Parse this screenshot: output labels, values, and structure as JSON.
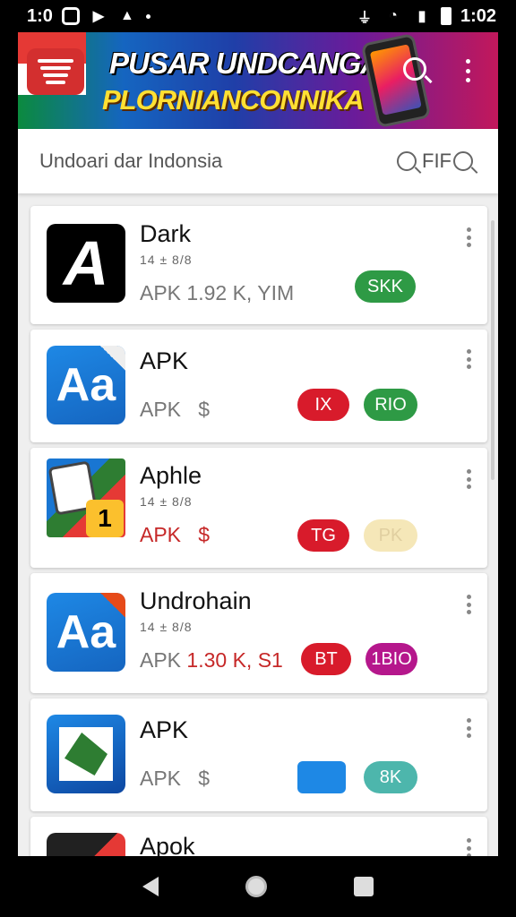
{
  "status_bar": {
    "time_left": "1:0",
    "time_right": "1:02"
  },
  "banner": {
    "title": "PUSAR UNDCANGAN",
    "subtitle": "PLORNIANCONNIKA"
  },
  "search": {
    "placeholder": "Undoari dar Indonsia",
    "filter_label": "FIF"
  },
  "apps": [
    {
      "name": "Dark",
      "meta": "14 ± 8/8",
      "info": "APK 1.92 K, YIM",
      "info_hl": "",
      "pills": [
        {
          "label": "SKK",
          "color": "#2e9a45"
        }
      ],
      "icon_letter": "A"
    },
    {
      "name": "APK",
      "meta": "",
      "info": "APK",
      "info_hl": "$",
      "pills": [
        {
          "label": "IX",
          "color": "#d81b2b"
        },
        {
          "label": "RIO",
          "color": "#2e9a45"
        }
      ],
      "icon_letter": "Aa"
    },
    {
      "name": "Aphle",
      "meta": "14 ± 8/8",
      "info": "APK",
      "info_hl": "$",
      "pills": [
        {
          "label": "TG",
          "color": "#d81b2b"
        },
        {
          "label": "PK",
          "color": "#f5e7b8"
        }
      ],
      "icon_letter": "1"
    },
    {
      "name": "Undrohain",
      "meta": "14 ± 8/8",
      "info": "APK",
      "info_hl": "1.30 K, S1",
      "pills": [
        {
          "label": "BT",
          "color": "#d81b2b"
        },
        {
          "label": "1BIO",
          "color": "#b5178c"
        }
      ],
      "icon_letter": "Aa"
    },
    {
      "name": "APK",
      "meta": "",
      "info": "APK",
      "info_hl": "$",
      "pills": [
        {
          "label": "",
          "color": "#1e88e5"
        },
        {
          "label": "8K",
          "color": "#4db6ac"
        }
      ],
      "icon_letter": ""
    },
    {
      "name": "Apok",
      "meta": "",
      "info": "",
      "info_hl": "",
      "pills": [],
      "icon_letter": ""
    }
  ]
}
